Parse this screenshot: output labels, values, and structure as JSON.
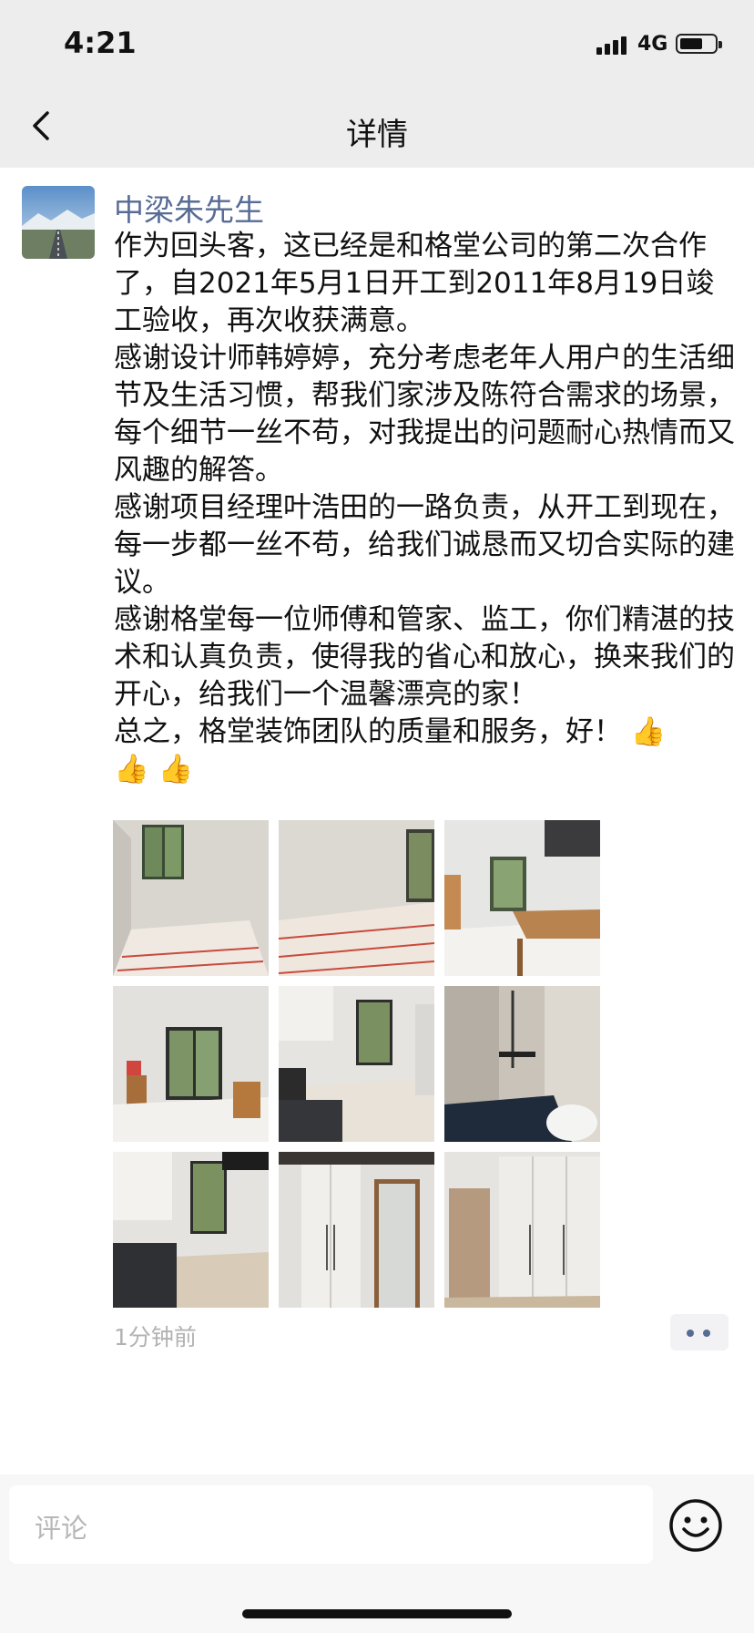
{
  "status": {
    "time": "4:21",
    "network": "4G"
  },
  "nav": {
    "title": "详情",
    "back_icon": "chevron-left-icon"
  },
  "post": {
    "author": "中梁朱先生",
    "paragraphs": [
      "作为回头客，这已经是和格堂公司的第二次合作了，自2021年5月1日开工到2011年8月19日竣工验收，再次收获满意。",
      "感谢设计师韩婷婷，充分考虑老年人用户的生活细节及生活习惯，帮我们家涉及陈符合需求的场景，每个细节一丝不苟，对我提出的问题耐心热情而又风趣的解答。",
      "感谢项目经理叶浩田的一路负责，从开工到现在，每一步都一丝不苟，给我们诚恳而又切合实际的建议。",
      "感谢格堂每一位师傅和管家、监工，你们精湛的技术和认真负责，使得我的省心和放心，换来我们的开心，给我们一个温馨漂亮的家！",
      "总之，格堂装饰团队的质量和服务，好！"
    ],
    "emoji_count": 3,
    "emoji": "👍",
    "photos": [
      "empty-room-window",
      "empty-room-protected-floor",
      "dining-area-wood-table",
      "living-room-balcony-door",
      "kitchen-window-stove",
      "bathroom-shower",
      "kitchen-corner-cabinets",
      "hallway-wardrobe-bathroom-door",
      "bedroom-wardrobe"
    ],
    "time_ago": "1分钟前"
  },
  "comment": {
    "placeholder": "评论",
    "emoji_icon": "smiley-icon"
  },
  "colors": {
    "link": "#576b95",
    "bar_bg": "#ededed"
  }
}
